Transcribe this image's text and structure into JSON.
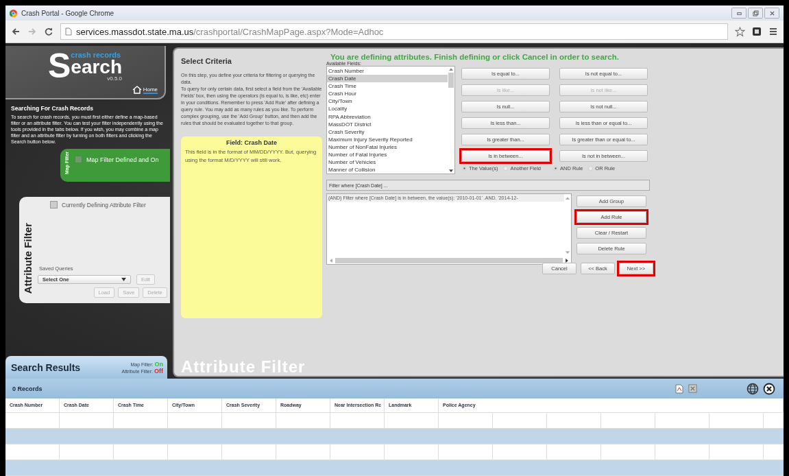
{
  "browser": {
    "title": "Crash Portal - Google Chrome",
    "url_host": "services.massdot.state.ma.us",
    "url_path": "/crashportal/CrashMapPage.aspx?Mode=Adhoc"
  },
  "logo": {
    "tagline": "crash records",
    "initial": "S",
    "word": "earch",
    "version": "v0.5.0",
    "home_link": "Home"
  },
  "intro": {
    "title": "Searching For Crash Records",
    "text": "To search for crash records, you must first either define a map-based filter or an attribute filter. You can test your filter independently using the tools provided in the tabs below. If you wish, you may combine a map filter and an attribute filter by turning on both filters and clicking the Search button below."
  },
  "map_filter": {
    "tab_label": "Map Filter",
    "checkbox_label": "Map Filter Defined and On",
    "checked": false
  },
  "attribute_filter": {
    "tab_label": "Attribute Filter",
    "checkbox_label": "Currently Defining Attribute Filter",
    "checked": false,
    "saved_queries_label": "Saved Queries",
    "select_value": "Select One",
    "buttons": [
      {
        "label": "Edit",
        "disabled": true
      },
      {
        "label": "Load",
        "disabled": true
      },
      {
        "label": "Save",
        "disabled": true
      },
      {
        "label": "Delete",
        "disabled": true
      }
    ]
  },
  "criteria": {
    "title": "Select Criteria",
    "paragraphs": [
      "On this step, you define your criteria for filtering or querying the data.",
      "To query for only certain data, first select a field from the 'Available Fields' box, then using the operators (is equal to, is like, etc) enter in your conditions.  Remember to press 'Add Rule' after defining a query rule.  You may add as many rules as you like.  To perform complex grouping, use the 'Add Group' button, and then add the rules that should be evaluated together to that group."
    ]
  },
  "field_note": {
    "title": "Field: Crash Date",
    "text": "This field is in the format of MM/DD/YYYY. But, querying using the format M/D/YYYY will still work."
  },
  "banner": "You are defining attributes. Finish defining or click Cancel in order to search.",
  "available_fields": {
    "label": "Available Fields:",
    "items": [
      {
        "label": "Crash Number",
        "selected": false
      },
      {
        "label": "Crash Date",
        "selected": true
      },
      {
        "label": "Crash Time",
        "selected": false
      },
      {
        "label": "Crash Hour",
        "selected": false
      },
      {
        "label": "City/Town",
        "selected": false
      },
      {
        "label": "Locality",
        "selected": false
      },
      {
        "label": "RPA Abbreviation",
        "selected": false
      },
      {
        "label": "MassDOT District",
        "selected": false
      },
      {
        "label": "Crash Severity",
        "selected": false
      },
      {
        "label": "Maximum Injury Severity Reported",
        "selected": false
      },
      {
        "label": "Number of NonFatal Injuries",
        "selected": false
      },
      {
        "label": "Number of Fatal Injuries",
        "selected": false
      },
      {
        "label": "Number of Vehicles",
        "selected": false
      },
      {
        "label": "Manner of Collision",
        "selected": false
      }
    ]
  },
  "operators": [
    {
      "label": "Is equal to...",
      "disabled": false,
      "highlighted": false
    },
    {
      "label": "Is not equal to...",
      "disabled": false,
      "highlighted": false
    },
    {
      "label": "Is like...",
      "disabled": true,
      "highlighted": false
    },
    {
      "label": "Is not like...",
      "disabled": true,
      "highlighted": false
    },
    {
      "label": "Is null...",
      "disabled": false,
      "highlighted": false
    },
    {
      "label": "Is not null...",
      "disabled": false,
      "highlighted": false
    },
    {
      "label": "Is less than...",
      "disabled": false,
      "highlighted": false
    },
    {
      "label": "Is less than or equal to...",
      "disabled": false,
      "highlighted": false
    },
    {
      "label": "Is greater than...",
      "disabled": false,
      "highlighted": false
    },
    {
      "label": "Is greater than or equal to...",
      "disabled": false,
      "highlighted": false
    },
    {
      "label": "Is in between...",
      "disabled": false,
      "highlighted": true
    },
    {
      "label": "Is not in between...",
      "disabled": false,
      "highlighted": false
    }
  ],
  "compare_options": [
    {
      "label": "The Value(s)",
      "selected": true
    },
    {
      "label": "Another Field",
      "selected": false
    }
  ],
  "rule_options": [
    {
      "label": "AND Rule",
      "selected": true
    },
    {
      "label": "OR Rule",
      "selected": false
    }
  ],
  "filter_preview": "Filter where [Crash Date] ...",
  "rules": [
    {
      "text": "(AND) Filter where [Crash Date] is in between, the value(s): '2010-01-01' .AND. '2014-12-"
    }
  ],
  "rule_buttons": [
    {
      "label": "Add Group",
      "highlighted": false
    },
    {
      "label": "Add Rule",
      "highlighted": true
    },
    {
      "label": "Clear / Restart",
      "highlighted": false
    },
    {
      "label": "Delete Rule",
      "highlighted": false
    }
  ],
  "nav_buttons": [
    {
      "label": "Cancel",
      "highlighted": false
    },
    {
      "label": "<< Back",
      "highlighted": false
    },
    {
      "label": "Next >>",
      "highlighted": true
    }
  ],
  "panel_caption": "Attribute Filter",
  "results": {
    "tab_title": "Search Results",
    "statuses": [
      {
        "label": "Map Filter:",
        "value": "On",
        "color": "#33c233"
      },
      {
        "label": "Attribute Filter:",
        "value": "Off",
        "color": "#e02424"
      }
    ],
    "count": "0 Records",
    "columns": [
      "Crash Number",
      "Crash Date",
      "Crash Time",
      "City/Town",
      "Crash Severity",
      "Roadway",
      "Near Intersection Rc",
      "Landmark",
      "Police Agency"
    ]
  }
}
